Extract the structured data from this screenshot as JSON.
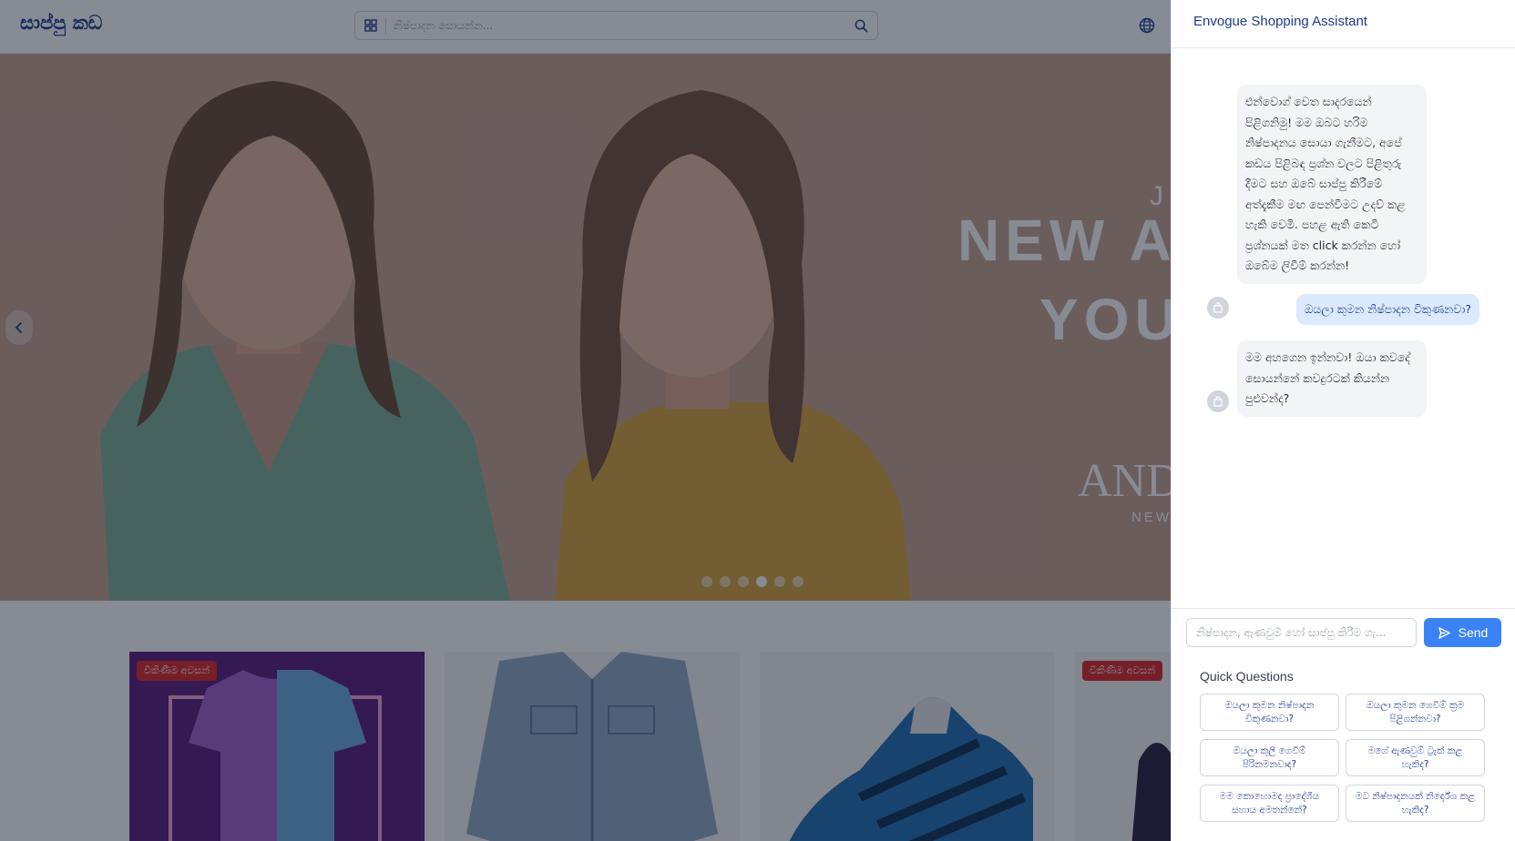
{
  "store": {
    "logo": "සාප්පු කඩ",
    "search_placeholder": "නිෂ්පාදන සොයන්න...",
    "hero": {
      "line1": "J",
      "line2": "NEW A",
      "line3": "YOU",
      "line4": "AND",
      "line5": "NEW"
    },
    "carousel": {
      "slide_count": 6,
      "active_index": 3
    },
    "products": [
      {
        "badge": "විකිණීම අවසන්"
      },
      {
        "badge": ""
      },
      {
        "badge": ""
      },
      {
        "badge": "විකිණීම අවසන්"
      }
    ]
  },
  "chat": {
    "title": "Envogue Shopping Assistant",
    "messages": [
      {
        "role": "bot",
        "text": "එන්වොග් වෙත සාදරයෙන් පිළිගනිමු! මම ඔබට හරිම නිෂ්පාදනය සොයා ගැනීමට, අපේ කඩය පිළිබඳ ප්‍රශ්න වලට පිළිතුරු දීමට සහ ඔබේ සාප්පු කිරීමේ අත්දැකීම මඟ පෙන්වීමට උදව් කළ හැකි වෙමි. පහළ ඇති කෙටි ප්‍රශ්නයක් මත click කරන්න හෝ ඔබේම ලිවීම් කරන්න!"
      },
      {
        "role": "user",
        "text": "ඔයලා කුමන නිෂ්පාදන විකුණනවා?"
      },
      {
        "role": "bot",
        "text": "මම අහගෙන ඉන්නවා! ඔයා කවදේ සොයන්නේ කවදුරටක් කියන්න පුළුවන්ද?"
      }
    ],
    "input_placeholder": "නිෂ්පාදන, ඇණවුම් හෝ සාප්පු කිරීම ගැ...",
    "send_label": "Send",
    "quick_title": "Quick Questions",
    "quick_questions": [
      "ඔයලා කුමන නිෂ්පාදන විකුණනවා?",
      "ඔයලා කුමන ගෙවීම් ක්‍රම පිළිගන්නවා?",
      "ඔයලා කුලී ගෙවීම් පිරිනමනවාද?",
      "මගේ ඇණවුම් ට්‍රැක් කළ හැකිද?",
      "මම කොහොමද ප්‍රාදේශීය සහාය අමතන්නේ?",
      "මට නිෂ්පාදනයක් නිර්දේශ කළ හැකිද?"
    ]
  },
  "colors": {
    "accent": "#3b82f6",
    "brand": "#1e3a8a",
    "sold_out_badge": "#dc2626",
    "hero_bg": "#c39a87"
  }
}
